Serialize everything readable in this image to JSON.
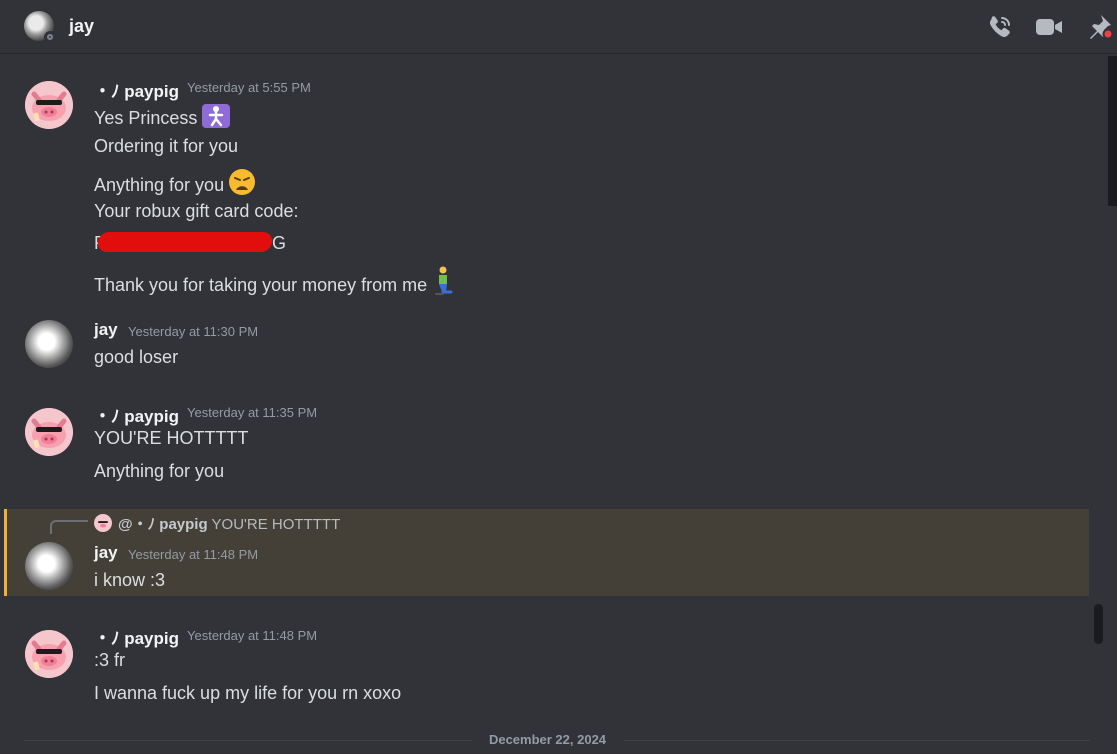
{
  "header": {
    "title": "jay",
    "icons": [
      "phone-call-icon",
      "video-call-icon",
      "pin-icon"
    ]
  },
  "messages": [
    {
      "author": "・ﾉ paypig",
      "timestamp": "Yesterday at 5:55 PM",
      "lines": [
        "Yes Princess",
        "Ordering it for you",
        "Anything for you",
        "Your robux gift card code:",
        "G",
        "Thank you for taking your money from me"
      ],
      "line_prefix": "R"
    },
    {
      "author": "jay",
      "timestamp": "Yesterday at 11:30 PM",
      "lines": [
        "good loser"
      ]
    },
    {
      "author": "・ﾉ paypig",
      "timestamp": "Yesterday at 11:35 PM",
      "lines": [
        "YOU'RE HOTTTTT",
        "Anything for you"
      ]
    },
    {
      "reply_to": {
        "author": "@・ﾉ paypig",
        "text": "YOU'RE HOTTTTT"
      },
      "author": "jay",
      "timestamp": "Yesterday at 11:48 PM",
      "lines": [
        "i know :3"
      ]
    },
    {
      "author": "・ﾉ paypig",
      "timestamp": "Yesterday at 11:48 PM",
      "lines": [
        ":3 fr",
        "I wanna fuck up my life for you rn xoxo"
      ]
    }
  ],
  "date_divider": "December 22, 2024",
  "colors": {
    "background": "#323339",
    "mention_highlight": "#444038",
    "mention_bar": "#f0b232",
    "redaction": "#e20d0d"
  }
}
